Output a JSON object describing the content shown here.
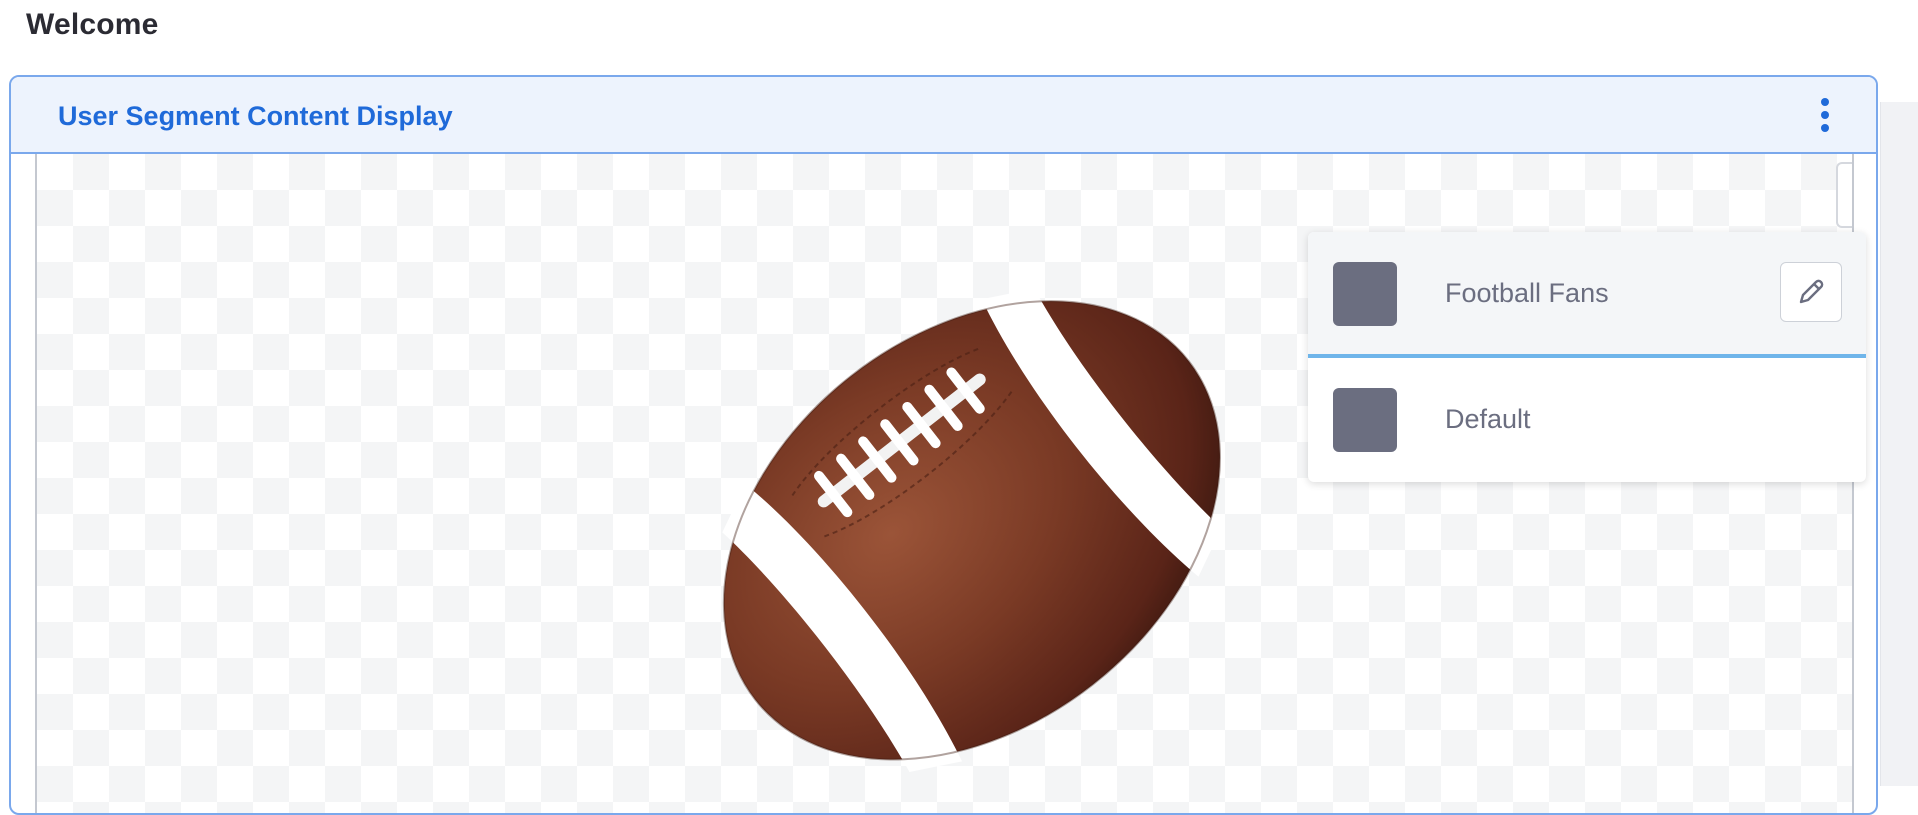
{
  "page": {
    "title": "Welcome"
  },
  "portlet": {
    "title": "User Segment Content Display",
    "menu_icon": "kebab-menu-icon"
  },
  "content": {
    "image": "american-football"
  },
  "segments": {
    "items": [
      {
        "label": "Football Fans",
        "swatch_color": "#6b6e80",
        "active": true,
        "edit_icon": "pencil-icon"
      },
      {
        "label": "Default",
        "swatch_color": "#6b6e80",
        "active": false
      }
    ]
  },
  "colors": {
    "accent": "#1f6ad9",
    "header_bg": "#edf3fd",
    "border": "#7aa8ec",
    "active_underline": "#6fb5ea"
  }
}
